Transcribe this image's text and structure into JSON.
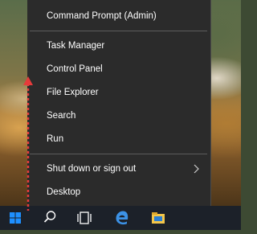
{
  "menu": {
    "items": [
      {
        "label": "Command Prompt (Admin)"
      },
      {
        "label": "Task Manager"
      },
      {
        "label": "Control Panel"
      },
      {
        "label": "File Explorer"
      },
      {
        "label": "Search"
      },
      {
        "label": "Run"
      },
      {
        "label": "Shut down or sign out",
        "icon": "chevron-right-icon"
      },
      {
        "label": "Desktop"
      }
    ]
  },
  "taskbar": {
    "icons": [
      "windows-start-icon",
      "search-icon",
      "task-view-icon",
      "edge-browser-icon",
      "file-explorer-icon"
    ]
  },
  "colors": {
    "menu_bg": "#2b2b2b",
    "taskbar_bg": "#1c2129",
    "start_blue": "#1e90ff",
    "annotation_red": "#e63b3b"
  }
}
